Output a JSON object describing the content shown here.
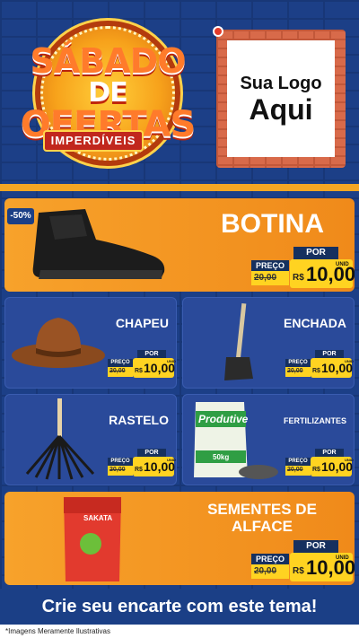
{
  "header": {
    "title_line1": "SÁBADO",
    "title_line2": "DE",
    "title_line3": "OFERTAS",
    "subtitle": "IMPERDÍVEIS",
    "logo_line1": "Sua Logo",
    "logo_line2": "Aqui"
  },
  "products": [
    {
      "name": "BOTINA",
      "badge": "-50%",
      "price_label": "PREÇO",
      "old_price": "20,00",
      "por": "POR",
      "currency": "R$",
      "price": "10,00",
      "unit": "UNID",
      "icon": "boot-icon"
    },
    {
      "name": "CHAPEU",
      "price_label": "PREÇO",
      "old_price": "20,00",
      "por": "POR",
      "currency": "R$",
      "price": "10,00",
      "unit": "UNID",
      "icon": "hat-icon"
    },
    {
      "name": "ENCHADA",
      "price_label": "PREÇO",
      "old_price": "20,00",
      "por": "POR",
      "currency": "R$",
      "price": "10,00",
      "unit": "UNID",
      "icon": "hoe-icon"
    },
    {
      "name": "RASTELO",
      "price_label": "PREÇO",
      "old_price": "20,00",
      "por": "POR",
      "currency": "R$",
      "price": "10,00",
      "unit": "UNID",
      "icon": "rake-icon"
    },
    {
      "name": "FERTILIZANTES",
      "price_label": "PREÇO",
      "old_price": "20,00",
      "por": "POR",
      "currency": "R$",
      "price": "10,00",
      "unit": "UNID",
      "icon": "fertilizer-bag-icon",
      "bag_brand": "Produtive",
      "bag_weight": "50kg"
    },
    {
      "name_line1": "SEMENTES DE",
      "name_line2": "ALFACE",
      "price_label": "PREÇO",
      "old_price": "20,00",
      "por": "POR",
      "currency": "R$",
      "price": "10,00",
      "unit": "UNID",
      "icon": "seed-packet-icon",
      "packet_brand": "SAKATA"
    }
  ],
  "footer": {
    "cta": "Crie seu encarte com este tema!",
    "disclaimer": "*Imagens Meramente Ilustrativas"
  },
  "colors": {
    "background": "#1b3f86",
    "accent_orange": "#f7a22b",
    "price_yellow": "#ffd321",
    "dark_navy": "#16305f"
  }
}
